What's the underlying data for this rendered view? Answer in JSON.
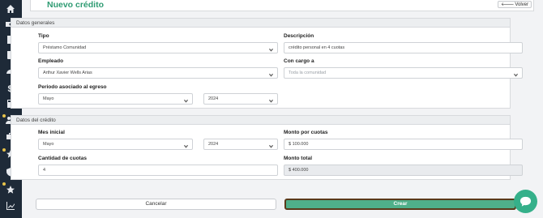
{
  "header": {
    "title": "Nuevo crédito",
    "back_label": "Volver"
  },
  "section_general": {
    "title": "Datos generales",
    "tipo_label": "Tipo",
    "tipo_value": "Préstamo Comunidad",
    "descripcion_label": "Descripción",
    "descripcion_value": "crédito personal en 4 cuotas",
    "empleado_label": "Empleado",
    "empleado_value": "Arthur Xavier Wells Arias",
    "cargo_label": "Con cargo a",
    "cargo_placeholder": "Toda la comunidad",
    "periodo_label": "Periodo asociado al egreso",
    "periodo_mes": "Mayo",
    "periodo_anio": "2024"
  },
  "section_credito": {
    "title": "Datos del crédito",
    "mes_label": "Mes inicial",
    "mes_value": "Mayo",
    "anio_value": "2024",
    "monto_cuotas_label": "Monto por cuotas",
    "monto_cuotas_value": "$ 100.000",
    "cantidad_label": "Cantidad de cuotas",
    "cantidad_value": "4",
    "monto_total_label": "Monto total",
    "monto_total_value": "$ 400.000"
  },
  "actions": {
    "cancel_label": "Cancelar",
    "create_label": "Crear"
  },
  "sidebar_icons": [
    "home-icon",
    "money-icon",
    "document-icon",
    "book-icon",
    "dashboard-icon",
    "dollar-icon",
    "calculator-icon",
    "users-icon",
    "briefcase-icon",
    "star-icon",
    "shield-icon",
    "star-icon",
    "chart-icon"
  ],
  "colors": {
    "accent": "#2e9b72",
    "create_button": "#4fb08a",
    "sidebar": "#1e2a38"
  }
}
